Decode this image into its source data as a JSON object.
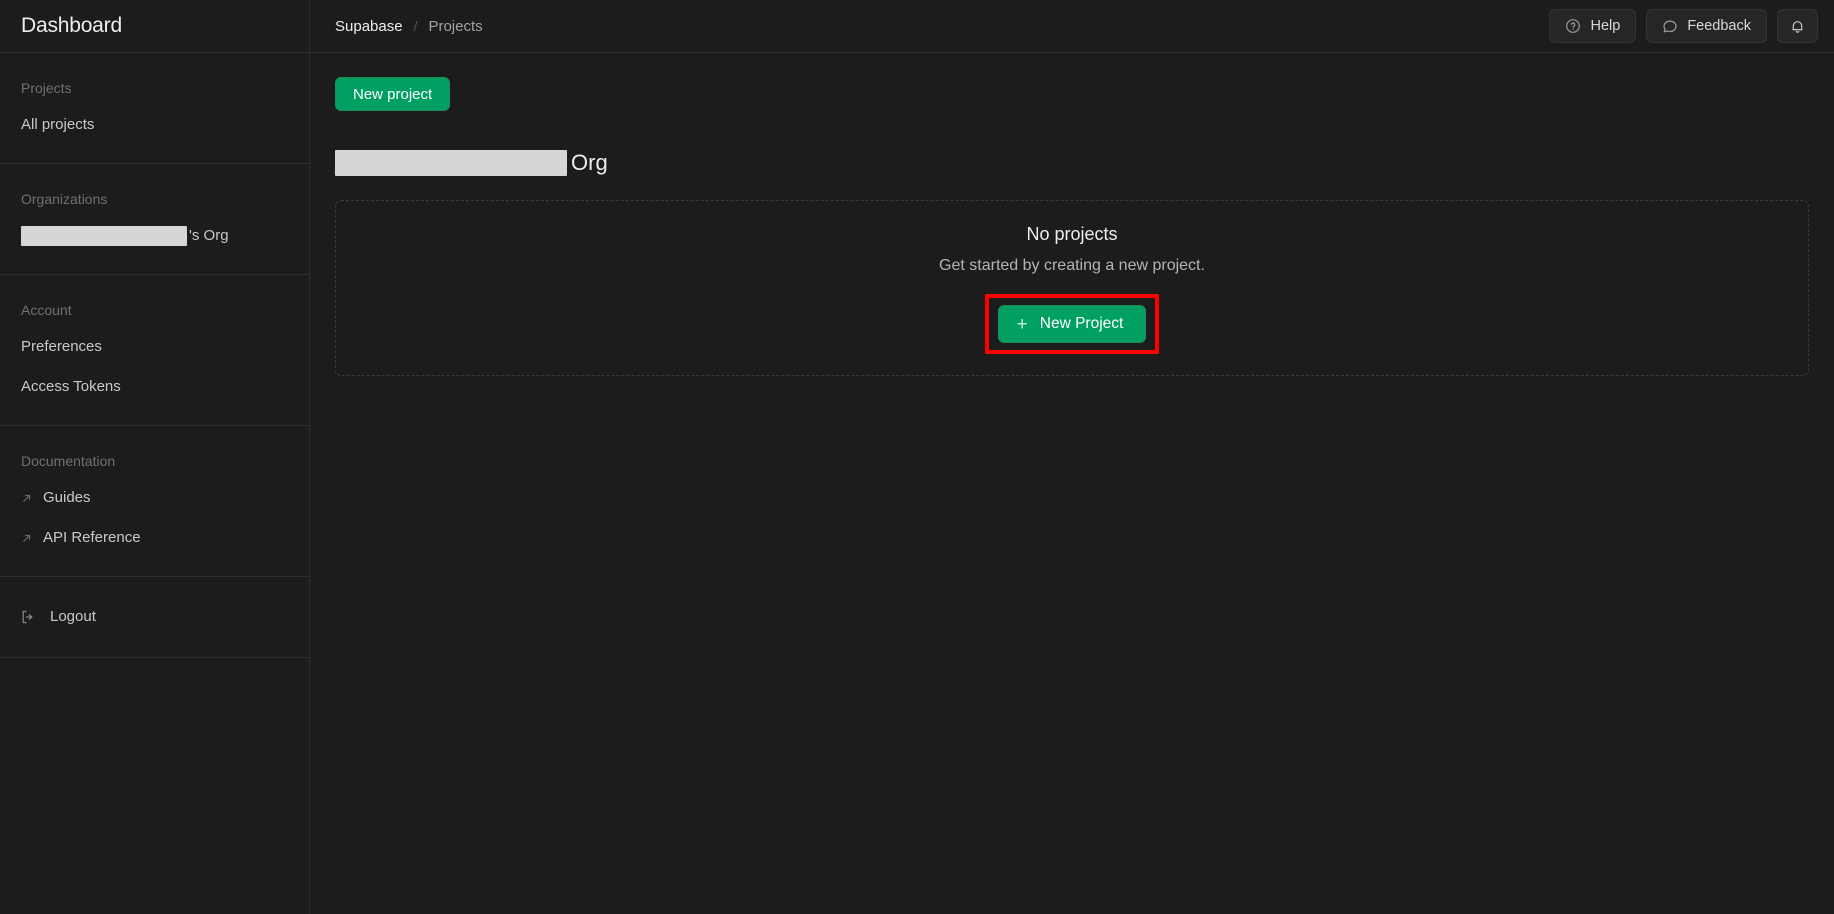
{
  "sidebar": {
    "title": "Dashboard",
    "sections": [
      {
        "heading": "Projects",
        "items": [
          {
            "label": "All projects",
            "icon": "",
            "redacted": false
          }
        ]
      },
      {
        "heading": "Organizations",
        "items": [
          {
            "label": "'s Org",
            "icon": "",
            "redacted": true,
            "redacted_width": 166
          }
        ]
      },
      {
        "heading": "Account",
        "items": [
          {
            "label": "Preferences",
            "icon": "",
            "redacted": false
          },
          {
            "label": "Access Tokens",
            "icon": "",
            "redacted": false
          }
        ]
      },
      {
        "heading": "Documentation",
        "items": [
          {
            "label": "Guides",
            "icon": "external-link-icon",
            "redacted": false
          },
          {
            "label": "API Reference",
            "icon": "external-link-icon",
            "redacted": false
          }
        ]
      }
    ],
    "logout": {
      "label": "Logout",
      "icon": "logout-icon"
    }
  },
  "topbar": {
    "breadcrumb": {
      "root": "Supabase",
      "separator": "/",
      "current": "Projects"
    },
    "actions": {
      "help": {
        "label": "Help",
        "icon": "question-circle-icon"
      },
      "feedback": {
        "label": "Feedback",
        "icon": "chat-bubble-icon"
      },
      "notifications": {
        "label": "",
        "icon": "bell-icon"
      }
    }
  },
  "main": {
    "new_project_button": "New project",
    "org_heading": {
      "redacted_name": "",
      "suffix": "Org"
    },
    "empty_state": {
      "title": "No projects",
      "subtitle": "Get started by creating a new project.",
      "cta_label": "New Project",
      "cta_icon": "plus-icon"
    }
  },
  "colors": {
    "background": "#1c1c1c",
    "border": "#2e2e2e",
    "accent_green": "#00a063",
    "highlight_red": "#ff0000",
    "text_primary": "#ededed",
    "text_muted": "#707070",
    "redaction": "#d6d6d6"
  }
}
